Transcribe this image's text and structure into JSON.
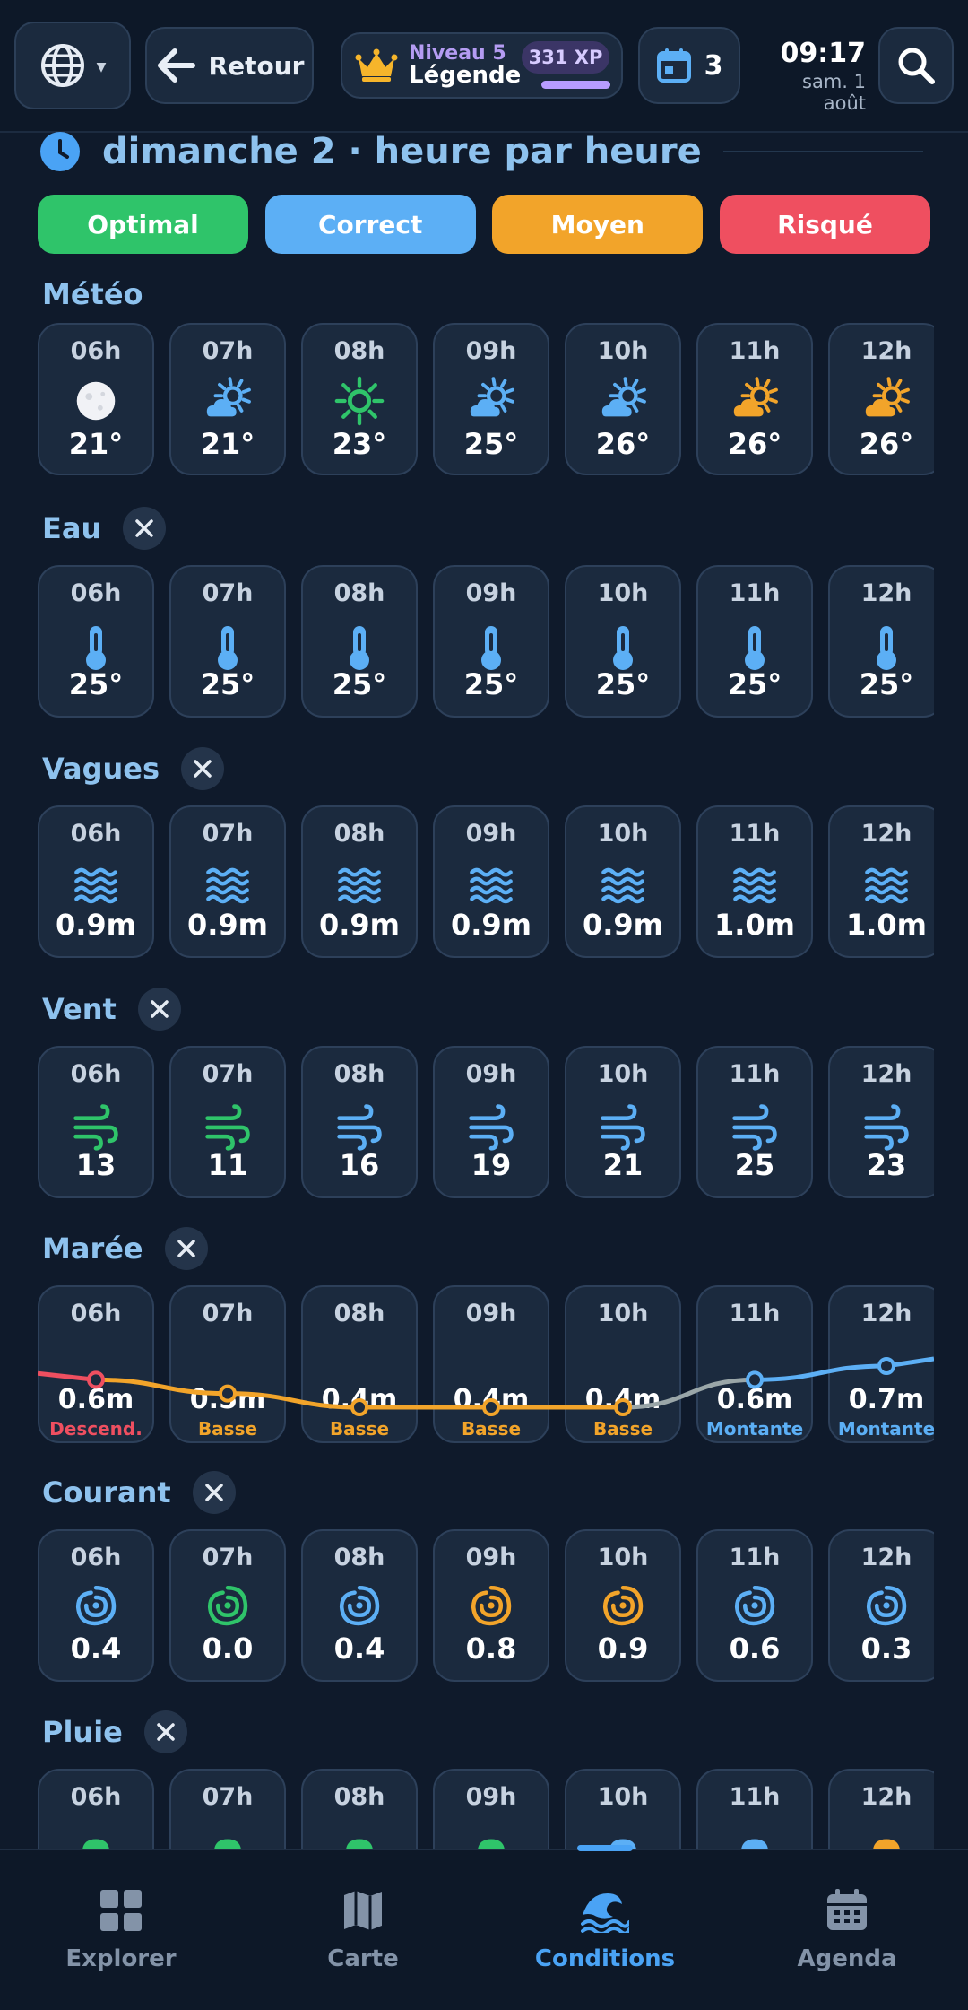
{
  "header": {
    "back_label": "Retour",
    "level_label": "Niveau 5",
    "rank_label": "Légende",
    "xp": "331 XP",
    "xp_progress": 0.85,
    "calendar_count": "3",
    "time": "09:17",
    "date": "sam. 1 août"
  },
  "heading": "dimanche 2 · heure par heure",
  "legend": [
    {
      "label": "Optimal",
      "color": "#2fc46a"
    },
    {
      "label": "Correct",
      "color": "#5caff5"
    },
    {
      "label": "Moyen",
      "color": "#f2a42a"
    },
    {
      "label": "Risqué",
      "color": "#ef4f60"
    }
  ],
  "hours": [
    "06h",
    "07h",
    "08h",
    "09h",
    "10h",
    "11h",
    "12h"
  ],
  "sections": {
    "meteo": {
      "title": "Météo",
      "icons": [
        "moon-icon",
        "partly-sunny-icon",
        "sun-icon",
        "partly-sunny-icon",
        "partly-sunny-icon",
        "partly-sunny-icon",
        "partly-sunny-icon"
      ],
      "colors": [
        "#e8eaf0",
        "#5caff5",
        "#2fc46a",
        "#5caff5",
        "#5caff5",
        "#f2a42a",
        "#f2a42a"
      ],
      "values": [
        "21°",
        "21°",
        "23°",
        "25°",
        "26°",
        "26°",
        "26°"
      ]
    },
    "eau": {
      "title": "Eau",
      "icons": [
        "thermometer-icon",
        "thermometer-icon",
        "thermometer-icon",
        "thermometer-icon",
        "thermometer-icon",
        "thermometer-icon",
        "thermometer-icon"
      ],
      "colors": [
        "#5caff5",
        "#5caff5",
        "#5caff5",
        "#5caff5",
        "#5caff5",
        "#5caff5",
        "#5caff5"
      ],
      "values": [
        "25°",
        "25°",
        "25°",
        "25°",
        "25°",
        "25°",
        "25°"
      ]
    },
    "vagues": {
      "title": "Vagues",
      "icons": [
        "waves-icon",
        "waves-icon",
        "waves-icon",
        "waves-icon",
        "waves-icon",
        "waves-icon",
        "waves-icon"
      ],
      "colors": [
        "#5caff5",
        "#5caff5",
        "#5caff5",
        "#5caff5",
        "#5caff5",
        "#5caff5",
        "#5caff5"
      ],
      "values": [
        "0.9m",
        "0.9m",
        "0.9m",
        "0.9m",
        "0.9m",
        "1.0m",
        "1.0m"
      ]
    },
    "vent": {
      "title": "Vent",
      "icons": [
        "wind-icon",
        "wind-icon",
        "wind-icon",
        "wind-icon",
        "wind-icon",
        "wind-icon",
        "wind-icon"
      ],
      "colors": [
        "#2fc46a",
        "#2fc46a",
        "#5caff5",
        "#5caff5",
        "#5caff5",
        "#5caff5",
        "#5caff5"
      ],
      "values": [
        "13",
        "11",
        "16",
        "19",
        "21",
        "25",
        "23"
      ]
    },
    "maree": {
      "title": "Marée",
      "values": [
        "0.6m",
        "0.5m",
        "0.4m",
        "0.4m",
        "0.4m",
        "0.6m",
        "0.7m"
      ],
      "levels": [
        0.6,
        0.5,
        0.4,
        0.4,
        0.4,
        0.6,
        0.7
      ],
      "states": [
        "Descend.",
        "Basse",
        "Basse",
        "Basse",
        "Basse",
        "Montante",
        "Montante"
      ],
      "state_colors": [
        "#ef4f60",
        "#f2a42a",
        "#f2a42a",
        "#f2a42a",
        "#f2a42a",
        "#5caff5",
        "#5caff5"
      ]
    },
    "courant": {
      "title": "Courant",
      "icons": [
        "swirl-icon",
        "swirl-icon",
        "swirl-icon",
        "swirl-icon",
        "swirl-icon",
        "swirl-icon",
        "swirl-icon"
      ],
      "colors": [
        "#5caff5",
        "#2fc46a",
        "#5caff5",
        "#f2a42a",
        "#f2a42a",
        "#5caff5",
        "#5caff5"
      ],
      "values": [
        "0.4",
        "0.0",
        "0.4",
        "0.8",
        "0.9",
        "0.6",
        "0.3"
      ]
    },
    "pluie": {
      "title": "Pluie",
      "icons": [
        "cloud-icon",
        "cloud-icon",
        "cloud-icon",
        "cloud-icon",
        "cloud-icon",
        "cloud-icon",
        "cloud-icon"
      ],
      "colors": [
        "#2fc46a",
        "#2fc46a",
        "#2fc46a",
        "#2fc46a",
        "#5caff5",
        "#5caff5",
        "#f2a42a"
      ]
    }
  },
  "nav": [
    {
      "label": "Explorer",
      "icon": "grid-icon",
      "active": false
    },
    {
      "label": "Carte",
      "icon": "map-icon",
      "active": false
    },
    {
      "label": "Conditions",
      "icon": "wave-icon",
      "active": true
    },
    {
      "label": "Agenda",
      "icon": "calendar-icon",
      "active": false
    }
  ],
  "colors": {
    "accent": "#4aa3f5",
    "inactive": "#8393a8",
    "heading": "#8ec2ee"
  }
}
